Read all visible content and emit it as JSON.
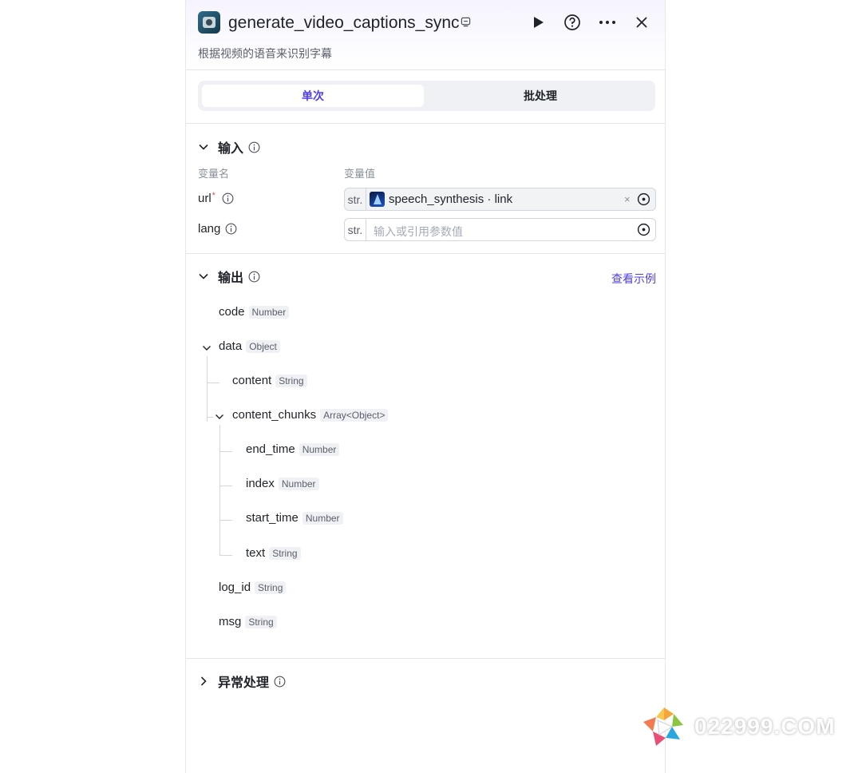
{
  "header": {
    "title": "generate_video_captions_sync",
    "description": "根据视频的语音来识别字幕"
  },
  "tabs": [
    {
      "label": "单次",
      "active": true
    },
    {
      "label": "批处理",
      "active": false
    }
  ],
  "input": {
    "title": "输入",
    "col_name": "变量名",
    "col_value": "变量值",
    "rows": [
      {
        "name": "url",
        "required_mark": "*",
        "type": "str.",
        "ref_node": "speech_synthesis",
        "ref_sep": " · ",
        "ref_field": "link",
        "clear": "×"
      },
      {
        "name": "lang",
        "type": "str.",
        "placeholder": "输入或引用参数值"
      }
    ]
  },
  "output": {
    "title": "输出",
    "example_link": "查看示例",
    "items": [
      {
        "name": "code",
        "type": "Number"
      },
      {
        "name": "data",
        "type": "Object"
      },
      {
        "name": "content",
        "type": "String"
      },
      {
        "name": "content_chunks",
        "type": "Array<Object>"
      },
      {
        "name": "end_time",
        "type": "Number"
      },
      {
        "name": "index",
        "type": "Number"
      },
      {
        "name": "start_time",
        "type": "Number"
      },
      {
        "name": "text",
        "type": "String"
      },
      {
        "name": "log_id",
        "type": "String"
      },
      {
        "name": "msg",
        "type": "String"
      }
    ]
  },
  "exception": {
    "title": "异常处理"
  },
  "watermark": {
    "text": "022999.COM"
  },
  "colors": {
    "accent": "#4e40e5",
    "required": "#e34d59"
  }
}
